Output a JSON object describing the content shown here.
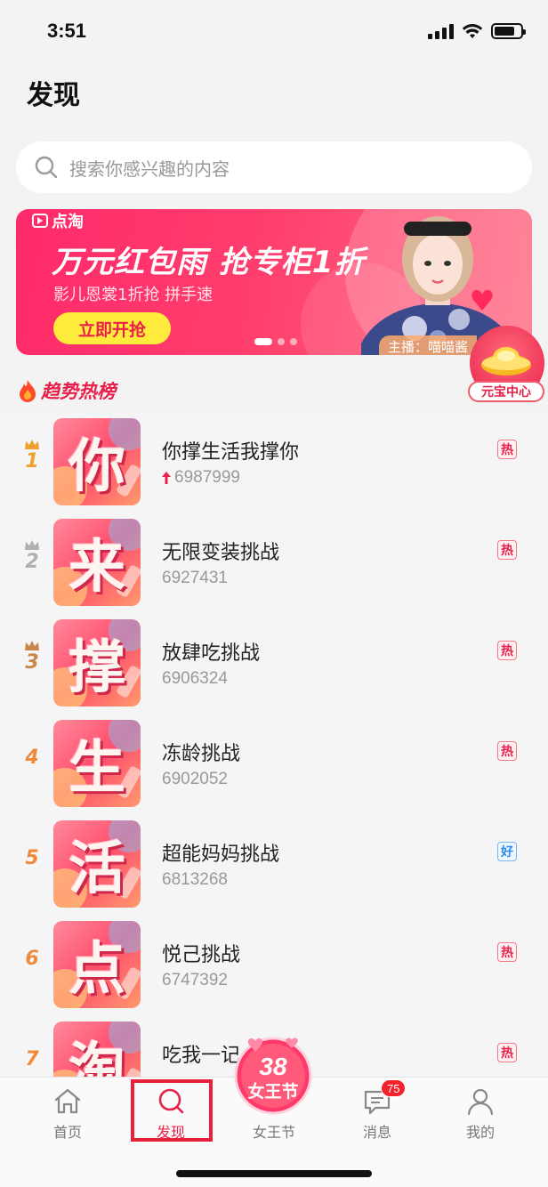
{
  "status_bar": {
    "time": "3:51"
  },
  "page": {
    "title": "发现"
  },
  "search": {
    "placeholder": "搜索你感兴趣的内容"
  },
  "banner": {
    "brand": "点淘",
    "headline": "万元红包雨 抢专柜1折",
    "subline": "影儿恩裳1折抢  拼手速",
    "cta": "立即开抢",
    "anchor": "主播：喵喵酱",
    "page_count": 3,
    "active_page": 1
  },
  "ingot_center": {
    "label": "元宝中心"
  },
  "trending": {
    "title": "趋势热榜",
    "items": [
      {
        "rank": "1",
        "char": "你",
        "title": "你撑生活我撑你",
        "count": "6987999",
        "rising": true,
        "tag": "热",
        "tag_type": "hot"
      },
      {
        "rank": "2",
        "char": "来",
        "title": "无限变装挑战",
        "count": "6927431",
        "rising": false,
        "tag": "热",
        "tag_type": "hot"
      },
      {
        "rank": "3",
        "char": "撑",
        "title": "放肆吃挑战",
        "count": "6906324",
        "rising": false,
        "tag": "热",
        "tag_type": "hot"
      },
      {
        "rank": "4",
        "char": "生",
        "title": "冻龄挑战",
        "count": "6902052",
        "rising": false,
        "tag": "热",
        "tag_type": "hot"
      },
      {
        "rank": "5",
        "char": "活",
        "title": "超能妈妈挑战",
        "count": "6813268",
        "rising": false,
        "tag": "好",
        "tag_type": "good"
      },
      {
        "rank": "6",
        "char": "点",
        "title": "悦己挑战",
        "count": "6747392",
        "rising": false,
        "tag": "热",
        "tag_type": "hot"
      },
      {
        "rank": "7",
        "char": "淘",
        "title": "吃我一记",
        "count": "",
        "rising": false,
        "tag": "热",
        "tag_type": "hot"
      }
    ]
  },
  "tabbar": {
    "tabs": [
      {
        "label": "首页",
        "icon": "home-icon",
        "active": false
      },
      {
        "label": "发现",
        "icon": "discover-search-icon",
        "active": true
      },
      {
        "label": "女王节",
        "icon": "queen-festival-icon",
        "active": false
      },
      {
        "label": "消息",
        "icon": "message-icon",
        "active": false
      },
      {
        "label": "我的",
        "icon": "profile-icon",
        "active": false
      }
    ],
    "queen_badge_number": "38",
    "queen_badge_text": "女王节",
    "message_badge": "75"
  },
  "colors": {
    "accent": "#e8204a",
    "rank_gold": "#f0a030",
    "rank_silver": "#b0b0b0",
    "rank_bronze": "#c8864a",
    "rank_other": "#f08a3a",
    "tag_good": "#2a8cf0"
  }
}
